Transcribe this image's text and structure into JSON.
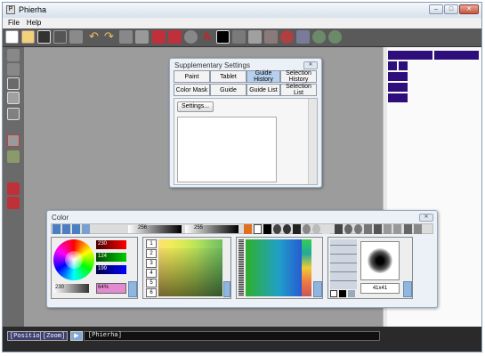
{
  "window": {
    "title": "Phierha"
  },
  "menu": [
    "File",
    "Help"
  ],
  "supplementary": {
    "title": "Supplementary Settings",
    "tabs": [
      {
        "label": "Paint",
        "selected": false
      },
      {
        "label": "Tablet",
        "selected": false
      },
      {
        "label": "Guide History",
        "selected": true
      },
      {
        "label": "Selection History",
        "selected": false
      },
      {
        "label": "Color Mask",
        "selected": false
      },
      {
        "label": "Guide",
        "selected": false
      },
      {
        "label": "Guide List",
        "selected": false
      },
      {
        "label": "Selection List",
        "selected": false
      }
    ],
    "settings_button": "Settings..."
  },
  "color": {
    "title": "Color",
    "brush_size": "256",
    "opacity": "255",
    "rgb": {
      "r": "230",
      "g": "124",
      "b": "199"
    },
    "brightness": "230",
    "output": "64%",
    "palette_tabs": [
      "1",
      "2",
      "3",
      "4",
      "5",
      "6"
    ],
    "pixel_size": "41x41"
  },
  "status": {
    "position_label": "[Position]",
    "zoom_label": "[Zoom]",
    "doc_name": "[Phierha]"
  },
  "colors": {
    "accent": "#2e0e7a",
    "canvas": "#9c9c9c",
    "selected_tab": "#b6d1ef"
  }
}
